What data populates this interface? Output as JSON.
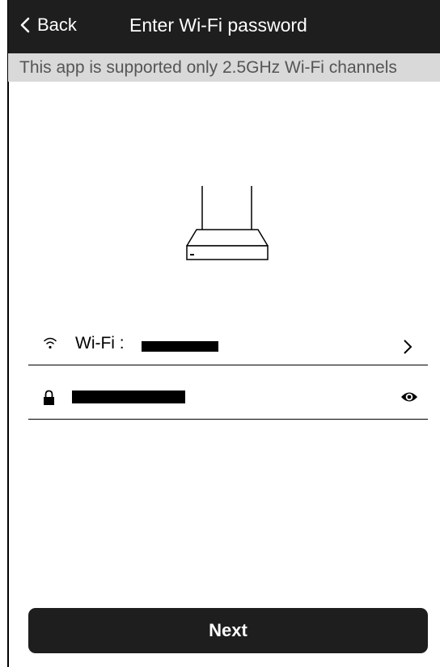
{
  "header": {
    "back_label": "Back",
    "title": "Enter Wi-Fi password"
  },
  "notice": "This app is supported only 2.5GHz Wi-Fi channels",
  "wifi_row": {
    "label": "Wi-Fi :",
    "icon": "wifi-icon",
    "trailing_icon": "chevron-right-icon"
  },
  "password_row": {
    "icon": "lock-icon",
    "trailing_icon": "eye-icon"
  },
  "next_label": "Next",
  "colors": {
    "header_bg": "#1e1e1e",
    "notice_bg": "#d9d9d9",
    "notice_text": "#555555",
    "button_bg": "#1e1e1e"
  }
}
